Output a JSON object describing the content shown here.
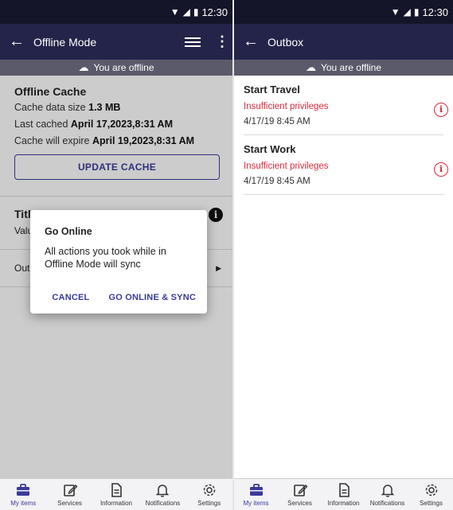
{
  "left": {
    "status_bar": {
      "time": "12:30"
    },
    "app_bar": {
      "title": "Offline Mode"
    },
    "offline_banner": "You are offline",
    "cache": {
      "title": "Offline Cache",
      "size_label": "Cache data size",
      "size_value": "1.3 MB",
      "last_label": "Last cached",
      "last_value": "April 17,2023,8:31 AM",
      "expire_label": "Cache will expire",
      "expire_value": "April 19,2023,8:31 AM",
      "update_button": "UPDATE CACHE"
    },
    "title_row": {
      "title_partial": "Titl",
      "value_partial": "Valu"
    },
    "outbox_row_partial": "Out",
    "dialog": {
      "title": "Go Online",
      "body": "All actions you took while in Offline Mode will sync",
      "cancel": "CANCEL",
      "confirm": "GO ONLINE & SYNC"
    }
  },
  "right": {
    "status_bar": {
      "time": "12:30"
    },
    "app_bar": {
      "title": "Outbox"
    },
    "offline_banner": "You are offline",
    "items": [
      {
        "title": "Start Travel",
        "error": "Insufficient privileges",
        "time": "4/17/19 8:45 AM"
      },
      {
        "title": "Start Work",
        "error": "Insufficient privileges",
        "time": "4/17/19 8:45 AM"
      }
    ]
  },
  "bottom_nav": {
    "items": [
      {
        "label": "My items",
        "icon": "briefcase-icon",
        "active": true
      },
      {
        "label": "Services",
        "icon": "edit-icon",
        "active": false
      },
      {
        "label": "Information",
        "icon": "document-icon",
        "active": false
      },
      {
        "label": "Notifications",
        "icon": "bell-icon",
        "active": false
      },
      {
        "label": "Settings",
        "icon": "gear-icon",
        "active": false
      }
    ]
  },
  "colors": {
    "status_bar": "#15152a",
    "app_bar": "#24244a",
    "offline_banner": "#5a5a6a",
    "accent": "#3a3a9a",
    "error": "#e0293c"
  }
}
